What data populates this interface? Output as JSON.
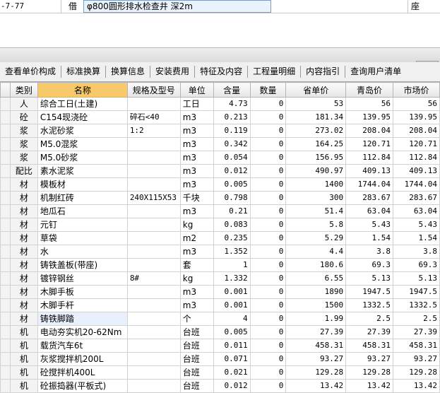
{
  "top_row": {
    "code": "-7-77",
    "type": "借",
    "name": "φ800圆形排水检查井 深2m",
    "unit": "座"
  },
  "tabs": [
    "查看单价构成",
    "标准换算",
    "换算信息",
    "安装费用",
    "特征及内容",
    "工程量明细",
    "内容指引",
    "查询用户清单"
  ],
  "columns": [
    "类别",
    "名称",
    "规格及型号",
    "单位",
    "含量",
    "数量",
    "省单价",
    "青岛价",
    "市场价"
  ],
  "rows": [
    {
      "type": "人",
      "name": "综合工日(土建)",
      "spec": "",
      "unit": "工日",
      "content": "4.73",
      "count": "0",
      "prov": "53",
      "qingdao": "56",
      "market": "56"
    },
    {
      "type": "砼",
      "name": "C154现浇砼",
      "spec": "碎石<40",
      "unit": "m3",
      "content": "0.213",
      "count": "0",
      "prov": "181.34",
      "qingdao": "139.95",
      "market": "139.95"
    },
    {
      "type": "浆",
      "name": "水泥砂浆",
      "spec": "1:2",
      "unit": "m3",
      "content": "0.119",
      "count": "0",
      "prov": "273.02",
      "qingdao": "208.04",
      "market": "208.04"
    },
    {
      "type": "浆",
      "name": "M5.0混浆",
      "spec": "",
      "unit": "m3",
      "content": "0.342",
      "count": "0",
      "prov": "164.25",
      "qingdao": "120.71",
      "market": "120.71"
    },
    {
      "type": "浆",
      "name": "M5.0砂浆",
      "spec": "",
      "unit": "m3",
      "content": "0.054",
      "count": "0",
      "prov": "156.95",
      "qingdao": "112.84",
      "market": "112.84"
    },
    {
      "type": "配比",
      "name": "素水泥浆",
      "spec": "",
      "unit": "m3",
      "content": "0.012",
      "count": "0",
      "prov": "490.97",
      "qingdao": "409.13",
      "market": "409.13"
    },
    {
      "type": "材",
      "name": "模板材",
      "spec": "",
      "unit": "m3",
      "content": "0.005",
      "count": "0",
      "prov": "1400",
      "qingdao": "1744.04",
      "market": "1744.04"
    },
    {
      "type": "材",
      "name": "机制红砖",
      "spec": "240X115X53",
      "unit": "千块",
      "content": "0.798",
      "count": "0",
      "prov": "300",
      "qingdao": "283.67",
      "market": "283.67"
    },
    {
      "type": "材",
      "name": "地瓜石",
      "spec": "",
      "unit": "m3",
      "content": "0.21",
      "count": "0",
      "prov": "51.4",
      "qingdao": "63.04",
      "market": "63.04"
    },
    {
      "type": "材",
      "name": "元钉",
      "spec": "",
      "unit": "kg",
      "content": "0.083",
      "count": "0",
      "prov": "5.8",
      "qingdao": "5.43",
      "market": "5.43"
    },
    {
      "type": "材",
      "name": "草袋",
      "spec": "",
      "unit": "m2",
      "content": "0.235",
      "count": "0",
      "prov": "5.29",
      "qingdao": "1.54",
      "market": "1.54"
    },
    {
      "type": "材",
      "name": "水",
      "spec": "",
      "unit": "m3",
      "content": "1.352",
      "count": "0",
      "prov": "4.4",
      "qingdao": "3.8",
      "market": "3.8"
    },
    {
      "type": "材",
      "name": "铸铁盖板(带座)",
      "spec": "",
      "unit": "套",
      "content": "1",
      "count": "0",
      "prov": "180.6",
      "qingdao": "69.3",
      "market": "69.3"
    },
    {
      "type": "材",
      "name": "镀锌钢丝",
      "spec": "8#",
      "unit": "kg",
      "content": "1.332",
      "count": "0",
      "prov": "6.55",
      "qingdao": "5.13",
      "market": "5.13"
    },
    {
      "type": "材",
      "name": "木脚手板",
      "spec": "",
      "unit": "m3",
      "content": "0.001",
      "count": "0",
      "prov": "1890",
      "qingdao": "1947.5",
      "market": "1947.5"
    },
    {
      "type": "材",
      "name": "木脚手杆",
      "spec": "",
      "unit": "m3",
      "content": "0.001",
      "count": "0",
      "prov": "1500",
      "qingdao": "1332.5",
      "market": "1332.5"
    },
    {
      "type": "材",
      "name": "铸铁脚踏",
      "spec": "",
      "unit": "个",
      "content": "4",
      "count": "0",
      "prov": "1.99",
      "qingdao": "2.5",
      "market": "2.5",
      "selected": true
    },
    {
      "type": "机",
      "name": "电动夯实机20-62Nm",
      "spec": "",
      "unit": "台班",
      "content": "0.005",
      "count": "0",
      "prov": "27.39",
      "qingdao": "27.39",
      "market": "27.39"
    },
    {
      "type": "机",
      "name": "载货汽车6t",
      "spec": "",
      "unit": "台班",
      "content": "0.011",
      "count": "0",
      "prov": "458.31",
      "qingdao": "458.31",
      "market": "458.31"
    },
    {
      "type": "机",
      "name": "灰浆搅拌机200L",
      "spec": "",
      "unit": "台班",
      "content": "0.071",
      "count": "0",
      "prov": "93.27",
      "qingdao": "93.27",
      "market": "93.27"
    },
    {
      "type": "机",
      "name": "砼搅拌机400L",
      "spec": "",
      "unit": "台班",
      "content": "0.021",
      "count": "0",
      "prov": "129.28",
      "qingdao": "129.28",
      "market": "129.28"
    },
    {
      "type": "机",
      "name": "砼振捣器(平板式)",
      "spec": "",
      "unit": "台班",
      "content": "0.012",
      "count": "0",
      "prov": "13.42",
      "qingdao": "13.42",
      "market": "13.42"
    }
  ]
}
